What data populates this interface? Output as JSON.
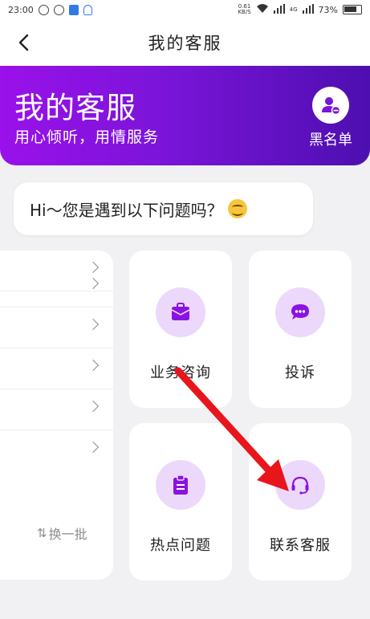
{
  "status_bar": {
    "time": "23:00",
    "net_speed_value": "0.61",
    "net_speed_unit": "KB/S",
    "signal_label": "4G",
    "battery": "73%"
  },
  "nav": {
    "title": "我的客服"
  },
  "banner": {
    "title": "我的客服",
    "subtitle": "用心倾听，用情服务",
    "blacklist_label": "黑名单"
  },
  "greeting": {
    "text": "Hi～您是遇到以下问题吗？"
  },
  "questions": {
    "swap_label": "换一批",
    "swap_icon": "⇅"
  },
  "services": [
    {
      "label": "业务咨询",
      "icon": "briefcase-icon"
    },
    {
      "label": "投诉",
      "icon": "chat-bubble-icon"
    },
    {
      "label": "热点问题",
      "icon": "clipboard-icon"
    },
    {
      "label": "联系客服",
      "icon": "headset-icon"
    }
  ],
  "colors": {
    "brand_purple": "#8a12e3",
    "brand_purple_dark": "#4d0fb0",
    "icon_circle_bg": "#ecd8fb",
    "annotation_arrow": "#e8161b"
  }
}
